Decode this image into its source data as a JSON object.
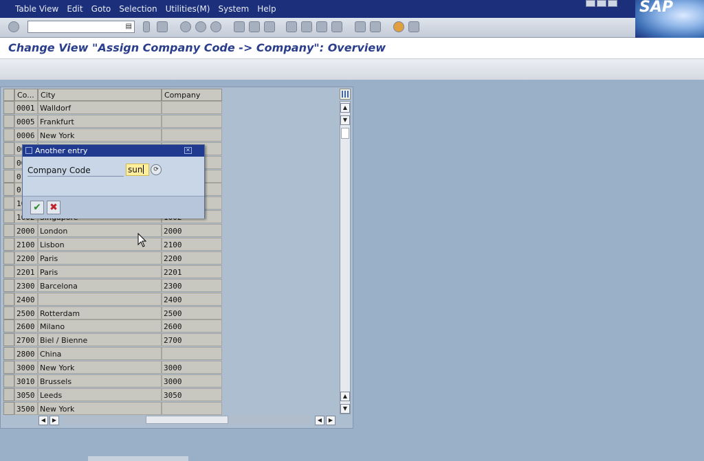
{
  "menu": [
    "Table View",
    "Edit",
    "Goto",
    "Selection",
    "Utilities(M)",
    "System",
    "Help"
  ],
  "logo": "SAP",
  "icons": {
    "command_ok": "check-icon",
    "save": "save-icon",
    "back": "back-icon",
    "exit": "exit-icon",
    "cancel": "cancel-icon",
    "print": "print-icon",
    "find": "find-icon",
    "help": "help-icon"
  },
  "page_title": "Change View \"Assign Company Code -> Company\": Overview",
  "table": {
    "headers": [
      "Co...",
      "City",
      "Company"
    ],
    "rows": [
      {
        "code": "0001",
        "city": "Walldorf",
        "company": ""
      },
      {
        "code": "0005",
        "city": "Frankfurt",
        "company": ""
      },
      {
        "code": "0006",
        "city": "New York",
        "company": ""
      },
      {
        "code": "00",
        "city": "",
        "company": ""
      },
      {
        "code": "00",
        "city": "",
        "company": ""
      },
      {
        "code": "01",
        "city": "",
        "company": ""
      },
      {
        "code": "01",
        "city": "",
        "company": ""
      },
      {
        "code": "10",
        "city": "",
        "company": ""
      },
      {
        "code": "1002",
        "city": "Singapore",
        "company": "1002"
      },
      {
        "code": "2000",
        "city": "London",
        "company": "2000"
      },
      {
        "code": "2100",
        "city": "Lisbon",
        "company": "2100"
      },
      {
        "code": "2200",
        "city": "Paris",
        "company": "2200"
      },
      {
        "code": "2201",
        "city": "Paris",
        "company": "2201"
      },
      {
        "code": "2300",
        "city": "Barcelona",
        "company": "2300"
      },
      {
        "code": "2400",
        "city": "",
        "company": "2400"
      },
      {
        "code": "2500",
        "city": "Rotterdam",
        "company": "2500"
      },
      {
        "code": "2600",
        "city": "Milano",
        "company": "2600"
      },
      {
        "code": "2700",
        "city": "Biel / Bienne",
        "company": "2700"
      },
      {
        "code": "2800",
        "city": "China",
        "company": ""
      },
      {
        "code": "3000",
        "city": "New York",
        "company": "3000"
      },
      {
        "code": "3010",
        "city": "Brussels",
        "company": "3000"
      },
      {
        "code": "3050",
        "city": "Leeds",
        "company": "3050"
      },
      {
        "code": "3500",
        "city": "New York",
        "company": ""
      }
    ]
  },
  "dialog": {
    "title": "Another entry",
    "label": "Company Code",
    "value": "sun"
  }
}
